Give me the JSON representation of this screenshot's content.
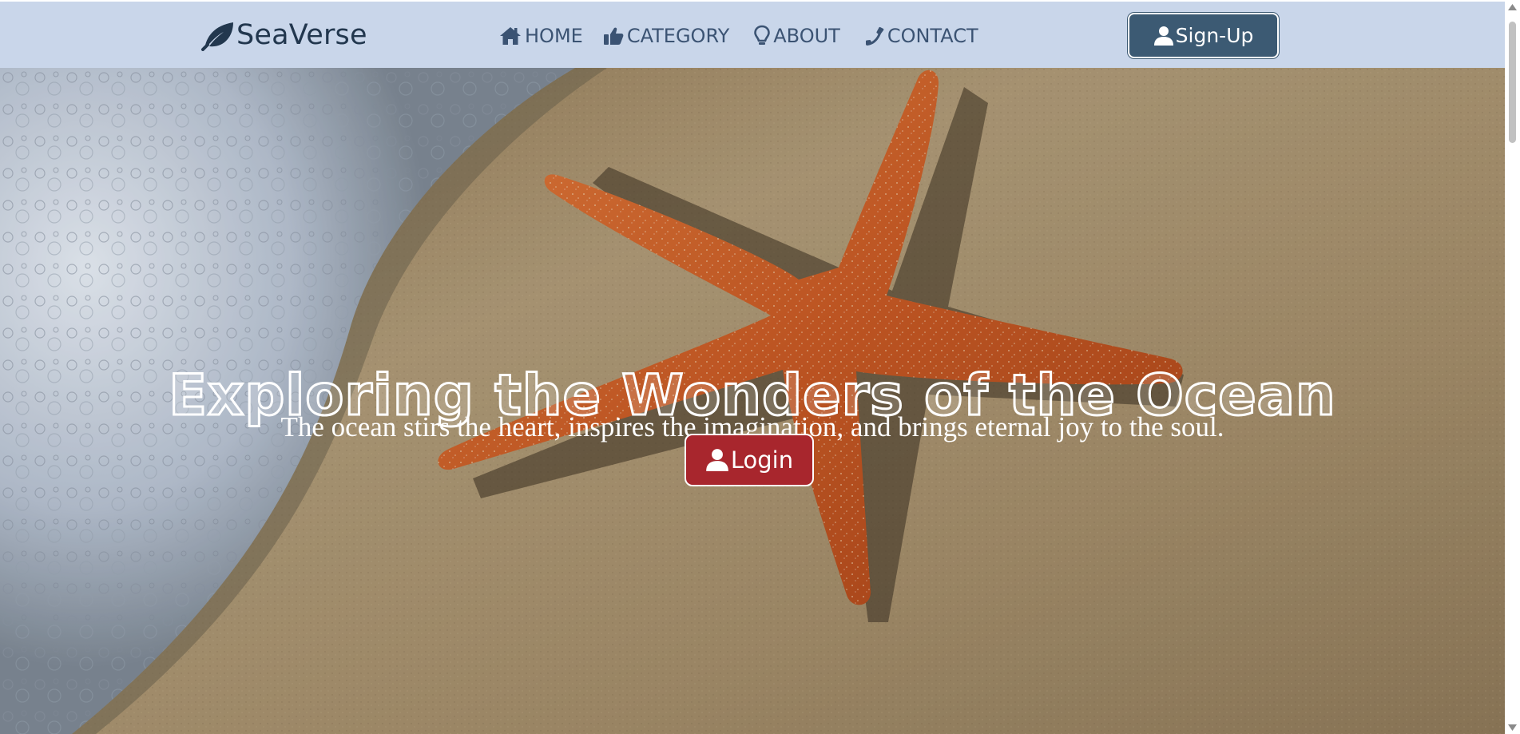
{
  "brand": {
    "name": "SeaVerse",
    "icon": "leaf-icon"
  },
  "nav": {
    "items": [
      {
        "label": " HOME",
        "icon": "house-icon"
      },
      {
        "label": "CATEGORY",
        "icon": "thumbs-up-icon"
      },
      {
        "label": "ABOUT",
        "icon": "lightbulb-icon"
      },
      {
        "label": "CONTACT",
        "icon": "phone-icon"
      }
    ],
    "signup": {
      "label": "Sign-Up",
      "icon": "user-icon"
    }
  },
  "hero": {
    "title": "Exploring the Wonders of the Ocean",
    "subtitle": "The ocean stirs the heart, inspires the imagination, and brings eternal joy to the soul.",
    "login": {
      "label": "Login",
      "icon": "user-icon"
    },
    "background": "starfish-on-beach-image"
  },
  "colors": {
    "navbar_bg": "#c9d6ea",
    "brand_text": "#22374e",
    "nav_text": "#3b5373",
    "signup_bg": "#3c5a73",
    "login_bg": "#a8262d"
  }
}
